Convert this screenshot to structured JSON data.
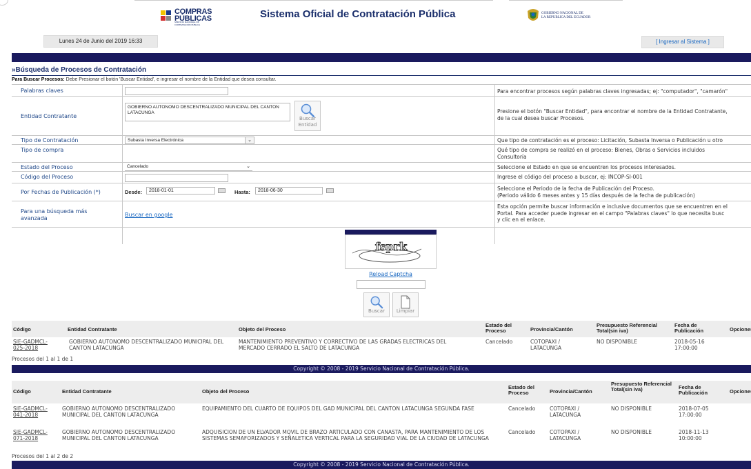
{
  "header": {
    "logo_line1": "COMPRAS",
    "logo_line2": "PÚBLICAS",
    "logo_small": "SERVICIO NACIONAL DE CONTRATACIÓN PÚBLICA",
    "title": "Sistema Oficial de Contratación Pública",
    "gob_line1": "GOBIERNO NACIONAL DE",
    "gob_line2": "LA REPUBLICA DEL ECUADOR",
    "date": "Lunes 24 de Junio del 2019 16:33",
    "login": "[ Ingresar al Sistema ]"
  },
  "search": {
    "title": "»Búsqueda de Procesos de Contratación",
    "instr_bold": "Para Buscar Procesos:",
    "instr_text": " Debe Presionar el botón 'Buscar Entidad', e ingresar el nombre de la Entidad que desea consultar.",
    "keywords": {
      "label": "Palabras claves",
      "value": "",
      "help": "Para encontrar procesos según palabras claves ingresadas; ej: \"computador\", \"camarón\""
    },
    "entity": {
      "label": "Entidad Contratante",
      "value": "GOBIERNO AUTONOMO DESCENTRALIZADO MUNICIPAL DEL CANTON LATACUNGA",
      "button": "Buscar Entidad",
      "help1": "Presione el botón \"Buscar Entidad\", para encontrar el nombre de la Entidad Contratante,",
      "help2": "de la cual desea buscar Procesos."
    },
    "type": {
      "label": "Tipo de Contratación",
      "value": "Subasta Inversa Electrónica",
      "help": "Que tipo de contratación es el proceso: Licitación, Subasta Inversa o Publicación u otro"
    },
    "purchase": {
      "label": "Tipo de compra",
      "help1": "Qué tipo de compra se realizó en el proceso: Bienes, Obras o Servicios incluidos",
      "help2": "Consultoría"
    },
    "status": {
      "label": "Estado del Proceso",
      "value": "Cancelado",
      "help": "Seleccione el Estado en que se encuentren los procesos interesados."
    },
    "code": {
      "label": "Código del Proceso",
      "value": "",
      "help": "Ingrese el código del proceso a buscar, ej: INCOP-SI-001"
    },
    "dates": {
      "label": "Por Fechas de Publicación (*)",
      "from_label": "Desde:",
      "from": "2018-01-01",
      "to_label": "Hasta:",
      "to": "2018-06-30",
      "help1": "Seleccione el Periodo de la fecha de Publicación del Proceso.",
      "help2": "(Periodo válido 6 meses antes y 15 días después de la fecha de publicación)"
    },
    "advanced": {
      "label1": "Para una búsqueda más",
      "label2": "avanzada",
      "link": "Buscar en google",
      "help1": "Esta opción permite buscar información e inclusive documentos que se encuentren en el",
      "help2": "Portal. Para acceder puede ingresar en el campo \"Palabras claves\" lo que necesita busc",
      "help3": "y clic en el enlace."
    },
    "captcha_text": "fsprk",
    "reload": "Reload Captcha",
    "search_btn": "Buscar",
    "clear_btn": "Limpiar"
  },
  "table1": {
    "headers": [
      "Código",
      "Entidad Contratante",
      "Objeto del Proceso",
      "Estado del Proceso",
      "Provincia/Cantón",
      "Presupuesto Referencial Total(sin iva)",
      "Fecha de Publicación",
      "Opciones"
    ],
    "rows": [
      {
        "code": "SIE-GADMCL-025-2018",
        "entity": "GOBIERNO AUTONOMO DESCENTRALIZADO MUNICIPAL DEL CANTON LATACUNGA",
        "object": "MANTENIMIENTO PREVENTIVO Y CORRECTIVO DE LAS GRADAS ELECTRICAS DEL MERCADO CERRADO EL SALTO DE LATACUNGA",
        "status": "Cancelado",
        "place": "COTOPAXI / LATACUNGA",
        "budget": "NO DISPONIBLE",
        "date": "2018-05-16 17:00:00"
      }
    ],
    "count": "Procesos del 1 al 1 de 1"
  },
  "table2": {
    "rows": [
      {
        "code": "SIE-GADMCL-041-2018",
        "entity": "GOBIERNO AUTONOMO DESCENTRALIZADO MUNICIPAL DEL CANTON LATACUNGA",
        "object": "EQUIPAMIENTO DEL CUARTO DE EQUIPOS DEL GAD MUNICIPAL DEL CANTON LATACUNGA SEGUNDA FASE",
        "status": "Cancelado",
        "place": "COTOPAXI / LATACUNGA",
        "budget": "NO DISPONIBLE",
        "date": "2018-07-05 17:00:00"
      },
      {
        "code": "SIE-GADMCL-071-2018",
        "entity": "GOBIERNO AUTONOMO DESCENTRALIZADO MUNICIPAL DEL CANTON LATACUNGA",
        "object": "ADQUISICION DE UN ELVADOR MOVIL DE BRAZO ARTICULADO CON CANASTA, PARA MANTENIMIENTO DE LOS SISTEMAS SEMAFORIZADOS Y SEÑALETICA VERTICAL PARA LA SEGURIDAD VIAL DE LA CIUDAD DE LATACUNGA",
        "status": "Cancelado",
        "place": "COTOPAXI / LATACUNGA",
        "budget": "NO DISPONIBLE",
        "date": "2018-11-13 10:00:00"
      }
    ],
    "count": "Procesos del 1 al 2 de 2"
  },
  "footer": {
    "copyright": "Copyright © 2008 - 2019 Servicio Nacional de Contratación Pública."
  }
}
